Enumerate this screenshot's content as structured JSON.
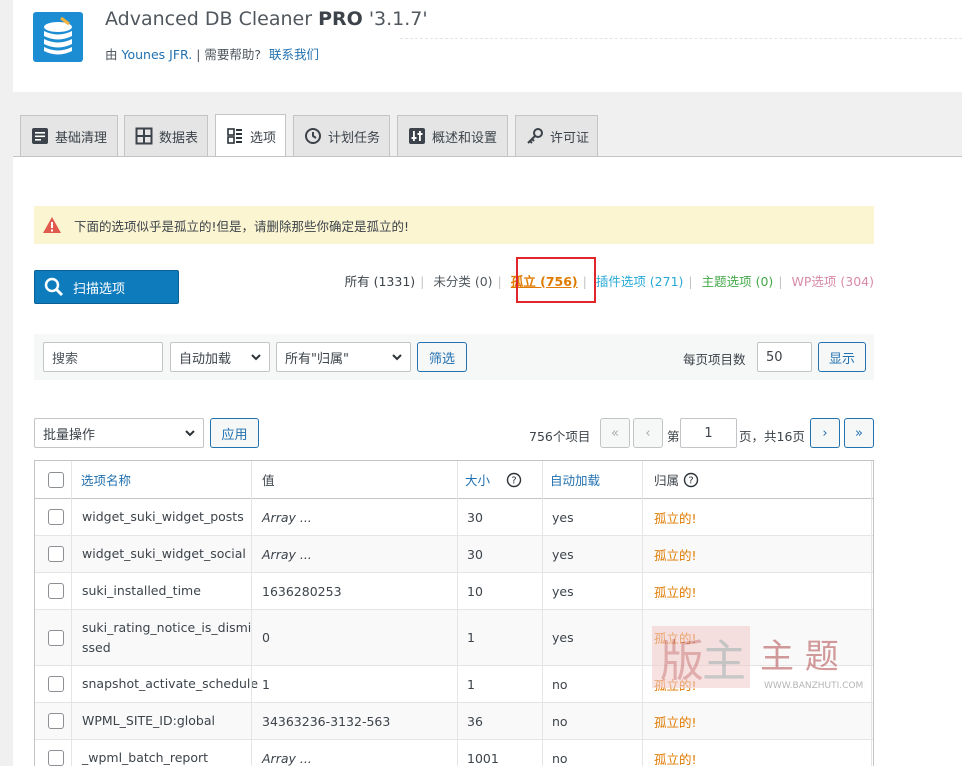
{
  "plugin": {
    "title_main": "Advanced DB Cleaner ",
    "title_pro": "PRO",
    "version": " '3.1.7'",
    "by_prefix": "由 ",
    "author": "Younes JFR.",
    "sep": " | ",
    "help": "需要帮助?",
    "contact": "联系我们"
  },
  "tabs": [
    {
      "label": "基础清理",
      "icon": "list-icon"
    },
    {
      "label": "数据表",
      "icon": "table-icon"
    },
    {
      "label": "选项",
      "icon": "options-icon"
    },
    {
      "label": "计划任务",
      "icon": "clock-icon"
    },
    {
      "label": "概述和设置",
      "icon": "settings-icon"
    },
    {
      "label": "许可证",
      "icon": "key-icon"
    }
  ],
  "warning": "下面的选项似乎是孤立的!但是，请删除那些你确定是孤立的!",
  "scan_label": "扫描选项",
  "filters": {
    "all": "所有 (1331)",
    "uncat": "未分类 (0)",
    "orphan": "孤立 (756)",
    "plugin": "插件选项 (271)",
    "theme": "主题选项 (0)",
    "wp": "WP选项 (304)",
    "divider": "|"
  },
  "filter_bar": {
    "search_placeholder": "搜索",
    "autoload": "自动加载",
    "belongs": "所有\"归属\"",
    "filter_btn": "筛选",
    "per_page_label": "每页项目数",
    "per_page": "50",
    "show_btn": "显示"
  },
  "bulk": {
    "action": "批量操作",
    "apply": "应用"
  },
  "pagination": {
    "count": "756个项目",
    "first": "«",
    "prev": "‹",
    "page_prefix": "第",
    "page": "1",
    "page_suffix": "页，共16页",
    "next": "›",
    "last": "»"
  },
  "table": {
    "headers": {
      "name": "选项名称",
      "value": "值",
      "size": "大小",
      "autoload": "自动加载",
      "belongs": "归属"
    },
    "rows": [
      {
        "name": "widget_suki_widget_posts",
        "value": "Array ...",
        "size": "30",
        "autoload": "yes",
        "belongs": "孤立的!"
      },
      {
        "name": "widget_suki_widget_social",
        "value": "Array ...",
        "size": "30",
        "autoload": "yes",
        "belongs": "孤立的!"
      },
      {
        "name": "suki_installed_time",
        "value": "1636280253",
        "size": "10",
        "autoload": "yes",
        "belongs": "孤立的!"
      },
      {
        "name": "suki_rating_notice_is_dismi",
        "name2": "ssed",
        "value": "0",
        "size": "1",
        "autoload": "yes",
        "belongs": "孤立的!"
      },
      {
        "name": "snapshot_activate_schedule",
        "value": "1",
        "size": "1",
        "autoload": "no",
        "belongs": "孤立的!"
      },
      {
        "name": "WPML_SITE_ID:global",
        "value": "34363236-3132-563",
        "size": "36",
        "autoload": "no",
        "belongs": "孤立的!"
      },
      {
        "name": "_wpml_batch_report",
        "value": "Array ...",
        "size": "1001",
        "autoload": "no",
        "belongs": "孤立的!"
      }
    ]
  },
  "watermark": {
    "main": "主 题",
    "url": "WWW.BANZHUTI.COM"
  },
  "colors": {
    "accent": "#2271b1",
    "orphan": "#e07b00",
    "plugin": "#27a9d6",
    "theme": "#44a84a",
    "wp": "#d88aa8",
    "logo": "#1c8cd3"
  }
}
